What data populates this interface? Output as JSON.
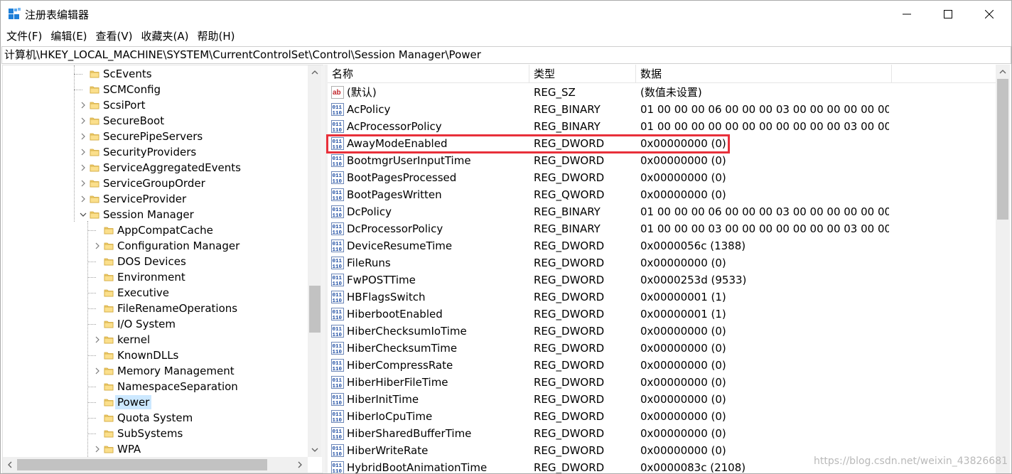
{
  "window": {
    "title": "注册表编辑器"
  },
  "menu": [
    "文件(F)",
    "编辑(E)",
    "查看(V)",
    "收藏夹(A)",
    "帮助(H)"
  ],
  "address": "计算机\\HKEY_LOCAL_MACHINE\\SYSTEM\\CurrentControlSet\\Control\\Session Manager\\Power",
  "tree": [
    {
      "label": "ScEvents",
      "level": 0,
      "expander": "none"
    },
    {
      "label": "SCMConfig",
      "level": 0,
      "expander": "none"
    },
    {
      "label": "ScsiPort",
      "level": 0,
      "expander": "collapsed"
    },
    {
      "label": "SecureBoot",
      "level": 0,
      "expander": "collapsed"
    },
    {
      "label": "SecurePipeServers",
      "level": 0,
      "expander": "collapsed"
    },
    {
      "label": "SecurityProviders",
      "level": 0,
      "expander": "collapsed"
    },
    {
      "label": "ServiceAggregatedEvents",
      "level": 0,
      "expander": "collapsed"
    },
    {
      "label": "ServiceGroupOrder",
      "level": 0,
      "expander": "collapsed"
    },
    {
      "label": "ServiceProvider",
      "level": 0,
      "expander": "collapsed"
    },
    {
      "label": "Session Manager",
      "level": 0,
      "expander": "expanded"
    },
    {
      "label": "AppCompatCache",
      "level": 1,
      "expander": "none"
    },
    {
      "label": "Configuration Manager",
      "level": 1,
      "expander": "collapsed"
    },
    {
      "label": "DOS Devices",
      "level": 1,
      "expander": "none"
    },
    {
      "label": "Environment",
      "level": 1,
      "expander": "none"
    },
    {
      "label": "Executive",
      "level": 1,
      "expander": "none"
    },
    {
      "label": "FileRenameOperations",
      "level": 1,
      "expander": "none"
    },
    {
      "label": "I/O System",
      "level": 1,
      "expander": "none"
    },
    {
      "label": "kernel",
      "level": 1,
      "expander": "collapsed"
    },
    {
      "label": "KnownDLLs",
      "level": 1,
      "expander": "none"
    },
    {
      "label": "Memory Management",
      "level": 1,
      "expander": "collapsed"
    },
    {
      "label": "NamespaceSeparation",
      "level": 1,
      "expander": "none"
    },
    {
      "label": "Power",
      "level": 1,
      "expander": "none",
      "selected": true
    },
    {
      "label": "Quota System",
      "level": 1,
      "expander": "none"
    },
    {
      "label": "SubSystems",
      "level": 1,
      "expander": "none"
    },
    {
      "label": "WPA",
      "level": 1,
      "expander": "collapsed"
    }
  ],
  "columns": {
    "name": "名称",
    "type": "类型",
    "data": "数据"
  },
  "values": [
    {
      "name": "(默认)",
      "type": "REG_SZ",
      "data": "(数值未设置)",
      "icon": "string-value-icon"
    },
    {
      "name": "AcPolicy",
      "type": "REG_BINARY",
      "data": "01 00 00 00 06 00 00 00 03 00 00 00 00 00 00 ...",
      "icon": "binary-value-icon"
    },
    {
      "name": "AcProcessorPolicy",
      "type": "REG_BINARY",
      "data": "01 00 00 00 00 00 00 00 00 00 00 00 03 00 00 ...",
      "icon": "binary-value-icon"
    },
    {
      "name": "AwayModeEnabled",
      "type": "REG_DWORD",
      "data": "0x00000000 (0)",
      "icon": "binary-value-icon",
      "highlighted": true
    },
    {
      "name": "BootmgrUserInputTime",
      "type": "REG_DWORD",
      "data": "0x00000000 (0)",
      "icon": "binary-value-icon"
    },
    {
      "name": "BootPagesProcessed",
      "type": "REG_DWORD",
      "data": "0x00000000 (0)",
      "icon": "binary-value-icon"
    },
    {
      "name": "BootPagesWritten",
      "type": "REG_QWORD",
      "data": "0x00000000 (0)",
      "icon": "binary-value-icon"
    },
    {
      "name": "DcPolicy",
      "type": "REG_BINARY",
      "data": "01 00 00 00 06 00 00 00 03 00 00 00 00 00 00 ...",
      "icon": "binary-value-icon"
    },
    {
      "name": "DcProcessorPolicy",
      "type": "REG_BINARY",
      "data": "01 00 00 00 03 00 00 00 00 00 00 00 03 00 00 ...",
      "icon": "binary-value-icon"
    },
    {
      "name": "DeviceResumeTime",
      "type": "REG_DWORD",
      "data": "0x0000056c (1388)",
      "icon": "binary-value-icon"
    },
    {
      "name": "FileRuns",
      "type": "REG_DWORD",
      "data": "0x00000000 (0)",
      "icon": "binary-value-icon"
    },
    {
      "name": "FwPOSTTime",
      "type": "REG_DWORD",
      "data": "0x0000253d (9533)",
      "icon": "binary-value-icon"
    },
    {
      "name": "HBFlagsSwitch",
      "type": "REG_DWORD",
      "data": "0x00000001 (1)",
      "icon": "binary-value-icon"
    },
    {
      "name": "HiberbootEnabled",
      "type": "REG_DWORD",
      "data": "0x00000001 (1)",
      "icon": "binary-value-icon"
    },
    {
      "name": "HiberChecksumIoTime",
      "type": "REG_DWORD",
      "data": "0x00000000 (0)",
      "icon": "binary-value-icon"
    },
    {
      "name": "HiberChecksumTime",
      "type": "REG_DWORD",
      "data": "0x00000000 (0)",
      "icon": "binary-value-icon"
    },
    {
      "name": "HiberCompressRate",
      "type": "REG_DWORD",
      "data": "0x00000000 (0)",
      "icon": "binary-value-icon"
    },
    {
      "name": "HiberHiberFileTime",
      "type": "REG_DWORD",
      "data": "0x00000000 (0)",
      "icon": "binary-value-icon"
    },
    {
      "name": "HiberInitTime",
      "type": "REG_DWORD",
      "data": "0x00000000 (0)",
      "icon": "binary-value-icon"
    },
    {
      "name": "HiberIoCpuTime",
      "type": "REG_DWORD",
      "data": "0x00000000 (0)",
      "icon": "binary-value-icon"
    },
    {
      "name": "HiberSharedBufferTime",
      "type": "REG_DWORD",
      "data": "0x00000000 (0)",
      "icon": "binary-value-icon"
    },
    {
      "name": "HiberWriteRate",
      "type": "REG_DWORD",
      "data": "0x00000000 (0)",
      "icon": "binary-value-icon"
    },
    {
      "name": "HybridBootAnimationTime",
      "type": "REG_DWORD",
      "data": "0x0000083c (2108)",
      "icon": "binary-value-icon"
    }
  ],
  "watermark": "https://blog.csdn.net/weixin_43826681"
}
